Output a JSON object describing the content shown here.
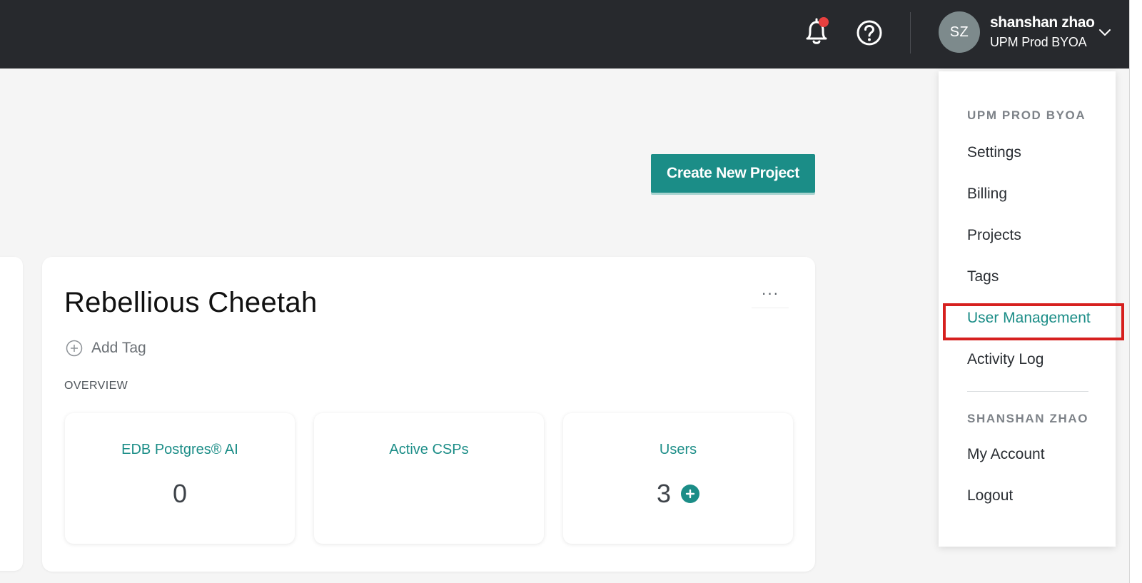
{
  "topbar": {
    "user_name": "shanshan zhao",
    "org_name": "UPM Prod BYOA",
    "avatar_initials": "SZ",
    "notification_badge": true
  },
  "toolbar": {
    "create_project_label": "Create New Project"
  },
  "project": {
    "name": "Rebellious Cheetah",
    "more_label": "···",
    "add_tag_label": "Add Tag",
    "overview_label": "OVERVIEW",
    "stats": [
      {
        "title": "EDB Postgres® AI",
        "value": "0"
      },
      {
        "title": "Active CSPs",
        "value": ""
      },
      {
        "title": "Users",
        "value": "3"
      }
    ]
  },
  "dropdown": {
    "org_heading": "UPM PROD BYOA",
    "org_items": [
      {
        "label": "Settings"
      },
      {
        "label": "Billing"
      },
      {
        "label": "Projects"
      },
      {
        "label": "Tags"
      },
      {
        "label": "User Management",
        "active": true
      },
      {
        "label": "Activity Log"
      }
    ],
    "user_heading": "SHANSHAN ZHAO",
    "user_items": [
      {
        "label": "My Account"
      },
      {
        "label": "Logout"
      }
    ]
  },
  "colors": {
    "topbar": "#27292d",
    "accent": "#1b8d87",
    "notification": "#e8403f",
    "highlight": "#d6201f"
  },
  "icons": [
    "bell-icon",
    "help-icon",
    "chevron-down-icon",
    "plus-circle-icon",
    "plus-icon"
  ]
}
